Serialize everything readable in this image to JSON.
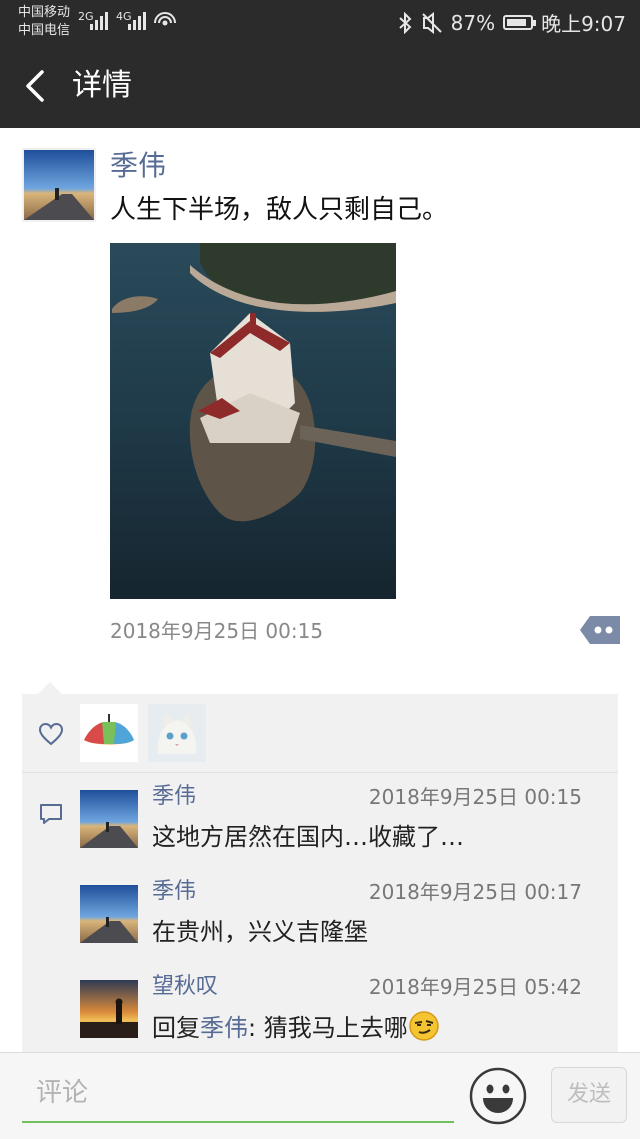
{
  "status_bar": {
    "carrier1": "中国移动",
    "carrier2": "中国电信",
    "network1": "2G",
    "network2": "4G",
    "battery": "87%",
    "battery_level": 0.87,
    "time": "晚上9:07"
  },
  "nav": {
    "title": "详情",
    "back_icon": "chevron-left-icon"
  },
  "post": {
    "author": "季伟",
    "text": "人生下半场，敌人只剩自己。",
    "time": "2018年9月25日 00:15",
    "more_icon": "more-dots-icon"
  },
  "likes": {
    "icon": "heart-icon",
    "count_avatars": 2
  },
  "comments": [
    {
      "name": "季伟",
      "time": "2018年9月25日 00:15",
      "text": "这地方居然在国内…收藏了…"
    },
    {
      "name": "季伟",
      "time": "2018年9月25日 00:17",
      "text": "在贵州，兴义吉隆堡"
    },
    {
      "name": "望秋叹",
      "time": "2018年9月25日 05:42",
      "reply_prefix": "回复",
      "reply_to": "季伟",
      "text": ": 猜我马上去哪"
    }
  ],
  "input": {
    "placeholder": "评论",
    "send_label": "发送"
  },
  "colors": {
    "link_blue": "#576b95",
    "header_dark": "#2b2b2b",
    "input_green": "#6fbf5f"
  }
}
